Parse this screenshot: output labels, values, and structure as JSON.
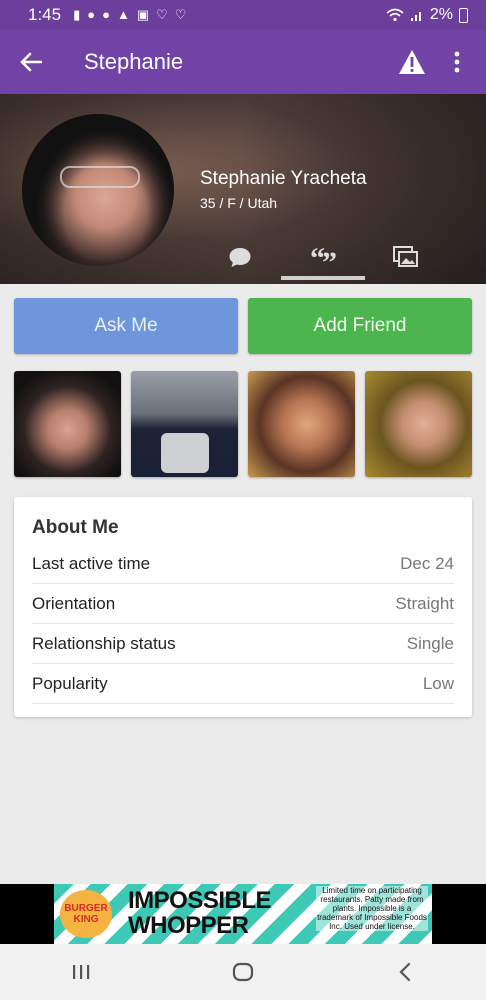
{
  "status_bar": {
    "time": "1:45",
    "battery": "2%",
    "icons": [
      "alert-icon",
      "messenger-icon",
      "messenger-icon",
      "mountain-icon",
      "image-icon",
      "heart-chat-icon",
      "heart-chat-icon"
    ]
  },
  "app_bar": {
    "title": "Stephanie",
    "back_icon": "back-arrow-icon",
    "warning_icon": "warning-icon",
    "more_icon": "more-vertical-icon"
  },
  "profile": {
    "name": "Stephanie Yracheta",
    "details": "35 / F / Utah",
    "tabs": [
      {
        "icon": "chat-bubble-icon",
        "active": false
      },
      {
        "icon": "quote-icon",
        "active": true
      },
      {
        "icon": "photos-icon",
        "active": false
      }
    ]
  },
  "actions": {
    "ask_me": "Ask Me",
    "add_friend": "Add Friend"
  },
  "about": {
    "title": "About Me",
    "rows": [
      {
        "label": "Last active time",
        "value": "Dec 24"
      },
      {
        "label": "Orientation",
        "value": "Straight"
      },
      {
        "label": "Relationship status",
        "value": "Single"
      },
      {
        "label": "Popularity",
        "value": "Low"
      }
    ]
  },
  "ad": {
    "brand_line1": "BURGER",
    "brand_line2": "KING",
    "headline_line1": "IMPOSSIBLE",
    "headline_line2": "WHOPPER",
    "fine_print": "Limited time on participating restaurants. Patty made from plants. Impossible is a trademark of Impossible Foods Inc. Used under license."
  },
  "colors": {
    "status_bar": "#6d3f9c",
    "app_bar": "#7143a6",
    "ask_me": "#6d96dc",
    "add_friend": "#4cb54d"
  }
}
